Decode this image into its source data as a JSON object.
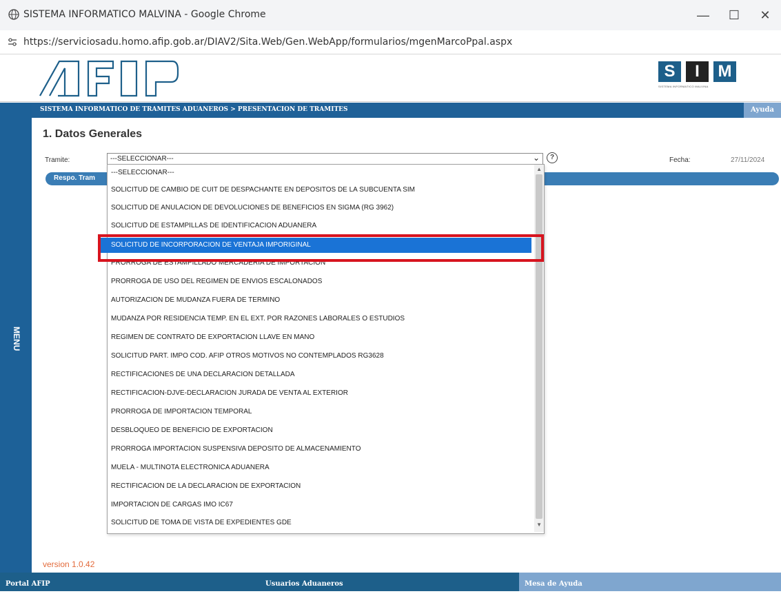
{
  "window": {
    "title": "SISTEMA INFORMATICO MALVINA - Google Chrome",
    "url": "https://serviciosadu.homo.afip.gob.ar/DIAV2/Sita.Web/Gen.WebApp/formularios/mgenMarcoPpal.aspx",
    "minimize": "—",
    "maximize": "☐",
    "close": "✕"
  },
  "header": {
    "logo_text": "AFIP",
    "sim_letters": [
      "S",
      "I",
      "M"
    ],
    "sim_caption": "SISTEMA INFORMATICO MALVINA"
  },
  "breadcrumb": "SISTEMA INFORMATICO DE TRAMITES ADUANEROS > PRESENTACION DE TRAMITES",
  "ayuda": "Ayuda",
  "menu_label": "MENU",
  "form": {
    "title": "1. Datos Generales",
    "tramite_label": "Tramite:",
    "tramite_value": "---SELECCIONAR---",
    "fecha_label": "Fecha:",
    "fecha_value": "27/11/2024",
    "respo_label": "Respo. Tram"
  },
  "dropdown_options": [
    "---SELECCIONAR---",
    "SOLICITUD DE CAMBIO DE CUIT DE DESPACHANTE EN DEPOSITOS DE LA SUBCUENTA SIM",
    "SOLICITUD DE ANULACION DE DEVOLUCIONES DE BENEFICIOS EN SIGMA (RG 3962)",
    "SOLICITUD DE ESTAMPILLAS DE IDENTIFICACION ADUANERA",
    "SOLICITUD DE INCORPORACION DE VENTAJA IMPORIGINAL",
    "PRORROGA DE ESTAMPILLADO MERCADERIA DE IMPORTACION",
    "PRORROGA DE USO DEL REGIMEN DE ENVIOS ESCALONADOS",
    "AUTORIZACION DE MUDANZA FUERA DE TERMINO",
    "MUDANZA POR RESIDENCIA TEMP. EN EL EXT. POR RAZONES LABORALES O ESTUDIOS",
    "REGIMEN DE CONTRATO DE EXPORTACION LLAVE EN MANO",
    "SOLICITUD PART. IMPO COD. AFIP OTROS MOTIVOS NO CONTEMPLADOS RG3628",
    "RECTIFICACIONES DE UNA DECLARACION DETALLADA",
    "RECTIFICACION-DJVE-DECLARACION JURADA DE VENTA AL EXTERIOR",
    "PRORROGA DE IMPORTACION TEMPORAL",
    "DESBLOQUEO DE BENEFICIO DE EXPORTACION",
    "PRORROGA IMPORTACION SUSPENSIVA DEPOSITO DE ALMACENAMIENTO",
    "MUELA - MULTINOTA ELECTRONICA ADUANERA",
    "RECTIFICACION DE LA DECLARACION DE EXPORTACION",
    "IMPORTACION DE CARGAS IMO IC67",
    "SOLICITUD DE TOMA DE VISTA DE EXPEDIENTES GDE"
  ],
  "selected_index": 4,
  "version": "version 1.0.42",
  "footer": {
    "portal": "Portal AFIP",
    "usuarios": "Usuarios Aduaneros",
    "mesa": "Mesa de Ayuda"
  },
  "colors": {
    "brand_blue": "#1d6198",
    "selection_blue": "#1a73d6",
    "highlight_red": "#d7141f",
    "version_orange": "#e36b3c"
  }
}
